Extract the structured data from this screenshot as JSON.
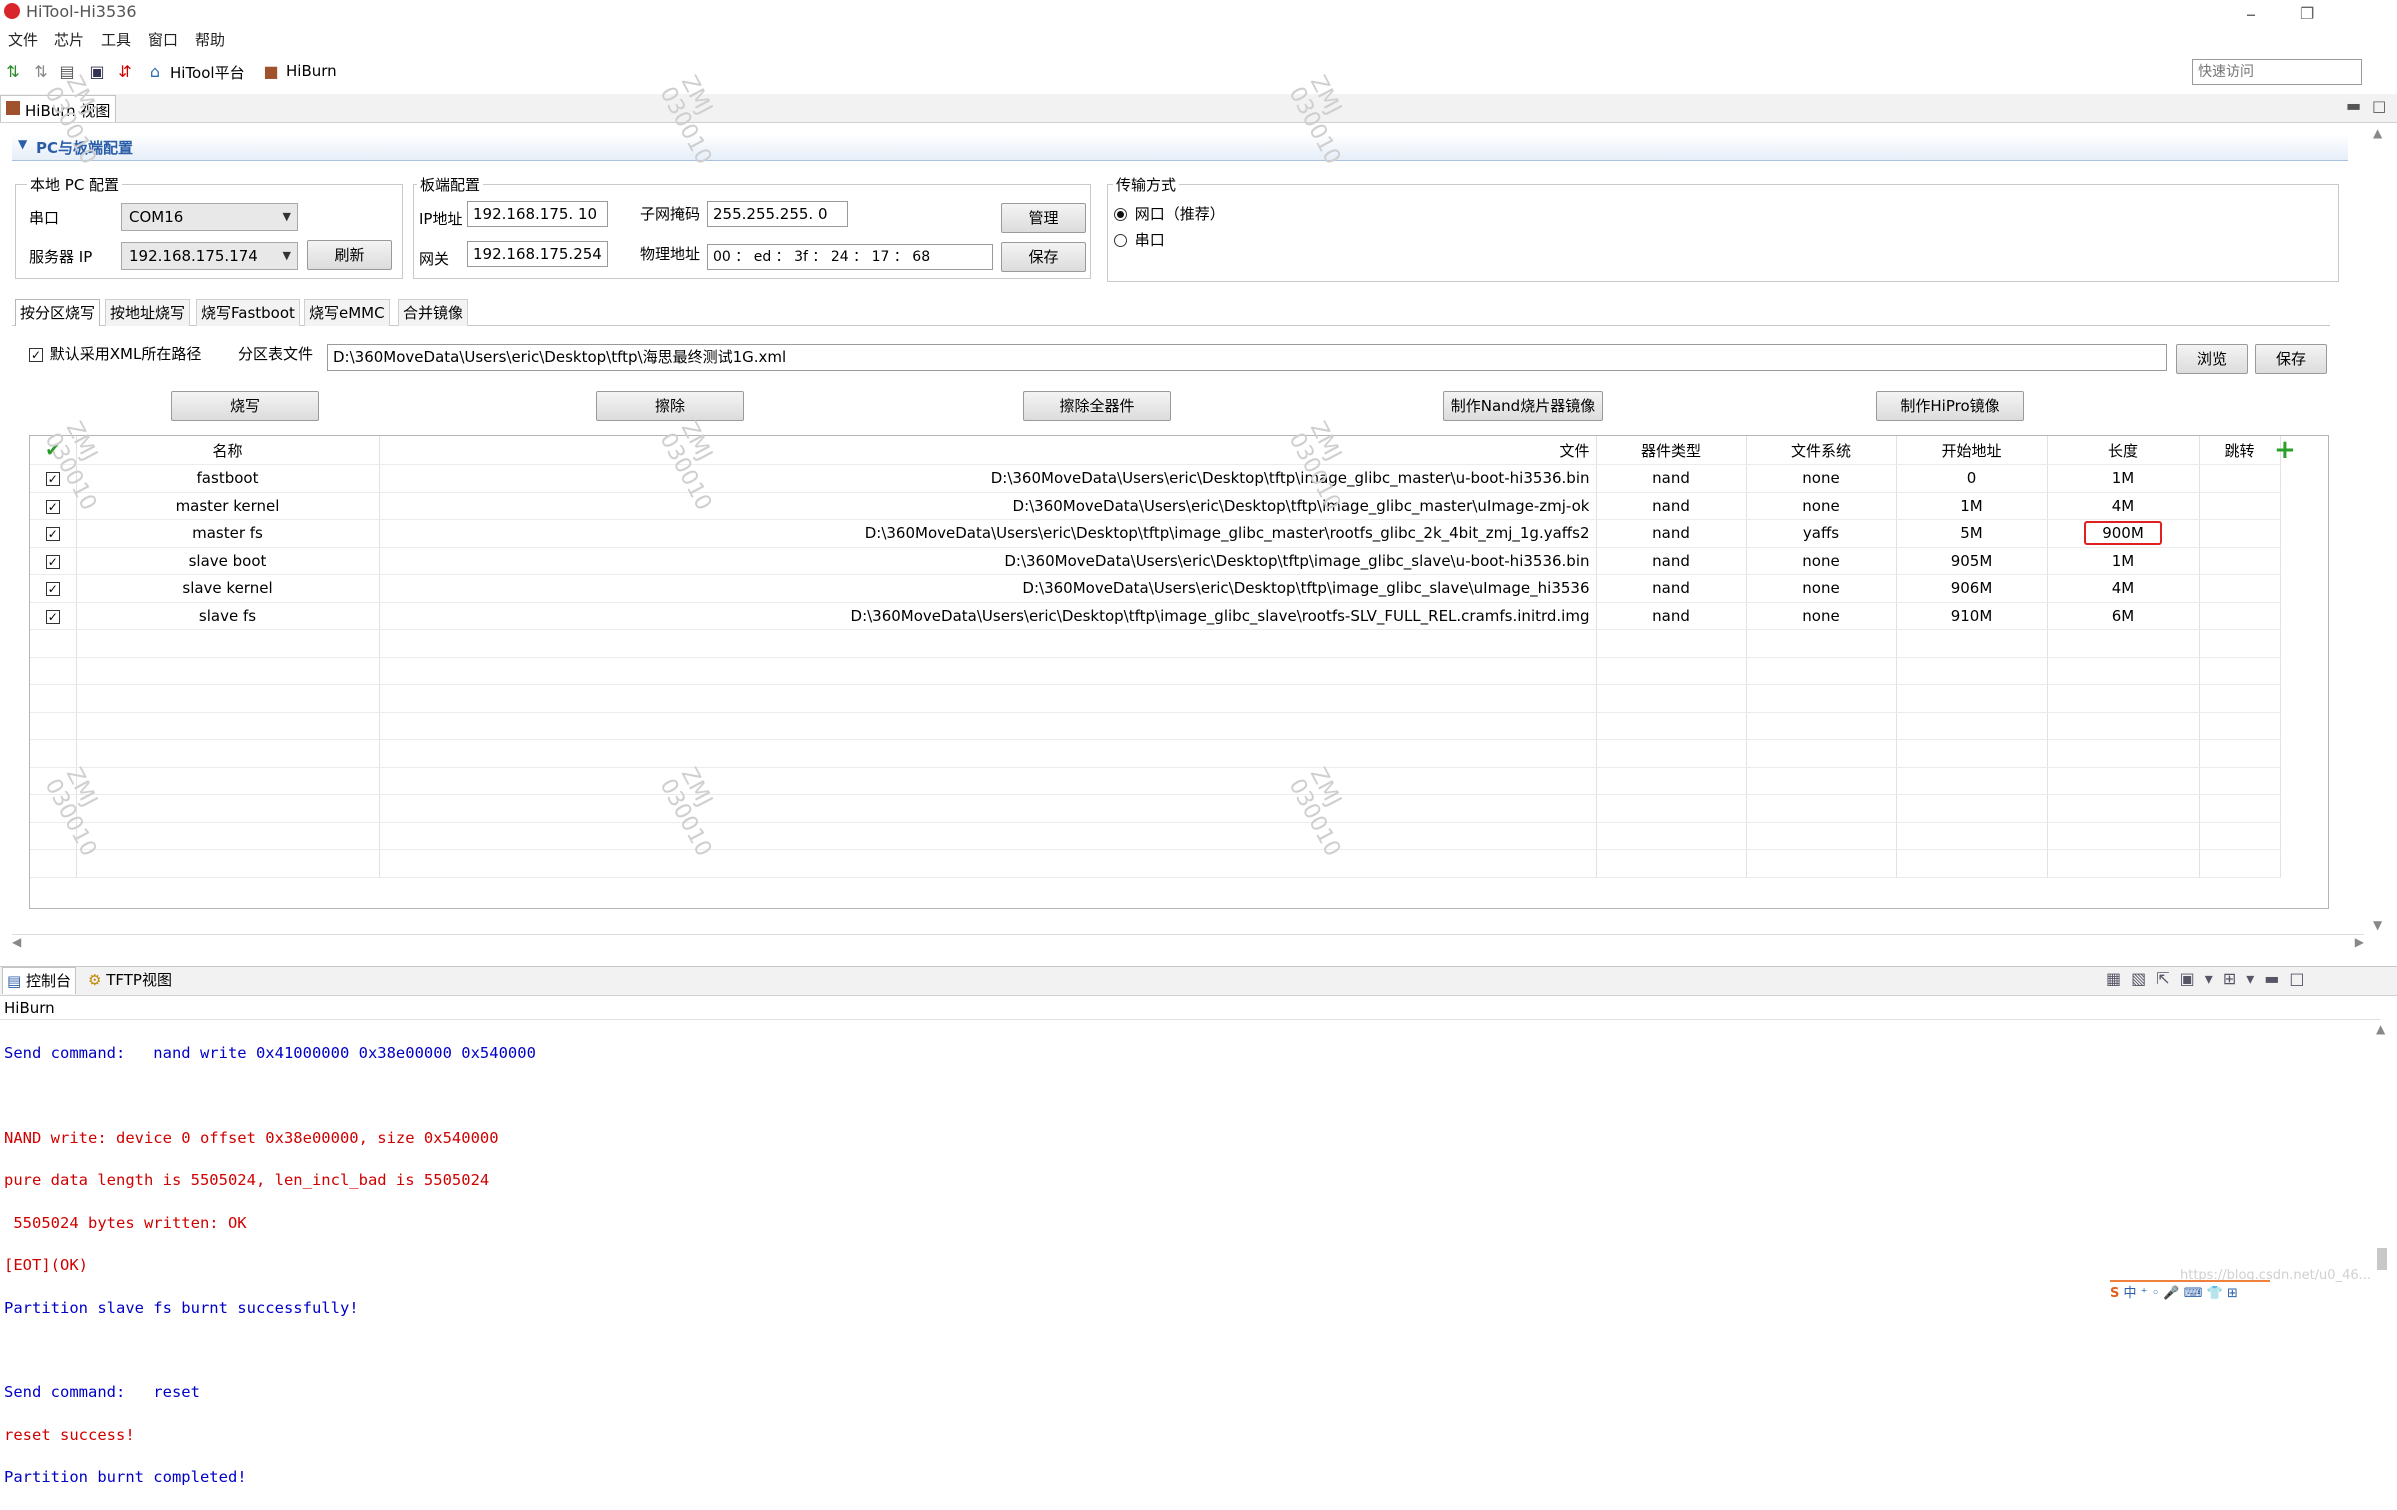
{
  "window": {
    "title": "HiTool-Hi3536",
    "menu": [
      "文件",
      "芯片",
      "工具",
      "窗口",
      "帮助"
    ],
    "minimize": "–",
    "restore": "❐"
  },
  "toolbar": {
    "hitool_platform": "HiTool平台",
    "hiburn": "HiBurn",
    "quick_access_placeholder": "快速访问"
  },
  "view_tab": {
    "label": "HiBurn 视图"
  },
  "section": {
    "title": "PC与板端配置"
  },
  "local_pc": {
    "title": "本地 PC 配置",
    "serial_label": "串口",
    "serial_value": "COM16",
    "server_ip_label": "服务器 IP",
    "server_ip_value": "192.168.175.174",
    "refresh_button": "刷新"
  },
  "board": {
    "title": "板端配置",
    "ip_label": "IP地址",
    "ip_value": "192.168.175. 10",
    "mask_label": "子网掩码",
    "mask_value": "255.255.255. 0",
    "manage_button": "管理",
    "gateway_label": "网关",
    "gateway_value": "192.168.175.254",
    "mac_label": "物理地址",
    "mac_value": "00 ： ed ： 3f ： 24 ： 17 ： 68",
    "save_button": "保存"
  },
  "transfer": {
    "title": "传输方式",
    "network_option": "网口（推荐）",
    "serial_option": "串口"
  },
  "burn_tabs": [
    "按分区烧写",
    "按地址烧写",
    "烧写Fastboot",
    "烧写eMMC",
    "合并镜像"
  ],
  "partition": {
    "use_xml_path_label": "默认采用XML所在路径",
    "table_file_label": "分区表文件",
    "table_file_value": "D:\\360MoveData\\Users\\eric\\Desktop\\tftp\\海思最终测试1G.xml",
    "browse_button": "浏览",
    "save_button": "保存"
  },
  "actions": {
    "burn": "烧写",
    "erase": "擦除",
    "erase_all": "擦除全器件",
    "make_nand_image": "制作Nand烧片器镜像",
    "make_hipro_image": "制作HiPro镜像"
  },
  "table": {
    "headers": [
      "名称",
      "文件",
      "器件类型",
      "文件系统",
      "开始地址",
      "长度",
      "跳转"
    ],
    "rows": [
      {
        "name": "fastboot",
        "file": "D:\\360MoveData\\Users\\eric\\Desktop\\tftp\\image_glibc_master\\u-boot-hi3536.bin",
        "device": "nand",
        "fs": "none",
        "start": "0",
        "length": "1M"
      },
      {
        "name": "master kernel",
        "file": "D:\\360MoveData\\Users\\eric\\Desktop\\tftp\\image_glibc_master\\uImage-zmj-ok",
        "device": "nand",
        "fs": "none",
        "start": "1M",
        "length": "4M"
      },
      {
        "name": "master fs",
        "file": "D:\\360MoveData\\Users\\eric\\Desktop\\tftp\\image_glibc_master\\rootfs_glibc_2k_4bit_zmj_1g.yaffs2",
        "device": "nand",
        "fs": "yaffs",
        "start": "5M",
        "length": "900M"
      },
      {
        "name": "slave boot",
        "file": "D:\\360MoveData\\Users\\eric\\Desktop\\tftp\\image_glibc_slave\\u-boot-hi3536.bin",
        "device": "nand",
        "fs": "none",
        "start": "905M",
        "length": "1M"
      },
      {
        "name": "slave kernel",
        "file": "D:\\360MoveData\\Users\\eric\\Desktop\\tftp\\image_glibc_slave\\uImage_hi3536",
        "device": "nand",
        "fs": "none",
        "start": "906M",
        "length": "4M"
      },
      {
        "name": "slave fs",
        "file": "D:\\360MoveData\\Users\\eric\\Desktop\\tftp\\image_glibc_slave\\rootfs-SLV_FULL_REL.cramfs.initrd.img",
        "device": "nand",
        "fs": "none",
        "start": "910M",
        "length": "6M"
      }
    ]
  },
  "console": {
    "tabs": [
      "控制台",
      "TFTP视图"
    ],
    "name": "HiBurn",
    "lines": [
      {
        "text": "Send command:   nand write 0x41000000 0x38e00000 0x540000",
        "color": "blue"
      },
      {
        "text": "",
        "color": "blue"
      },
      {
        "text": "NAND write: device 0 offset 0x38e00000, size 0x540000",
        "color": "red"
      },
      {
        "text": "pure data length is 5505024, len_incl_bad is 5505024",
        "color": "red"
      },
      {
        "text": " 5505024 bytes written: OK",
        "color": "red"
      },
      {
        "text": "[EOT](OK)",
        "color": "red"
      },
      {
        "text": "Partition slave fs burnt successfully!",
        "color": "blue"
      },
      {
        "text": "",
        "color": "blue"
      },
      {
        "text": "Send command:   reset",
        "color": "blue"
      },
      {
        "text": "reset success!",
        "color": "red"
      },
      {
        "text": "Partition burnt completed!",
        "color": "blue"
      }
    ]
  },
  "watermark": "ZMJ\n030010",
  "footer_url": "https://blog.csdn.net/u0_46..."
}
